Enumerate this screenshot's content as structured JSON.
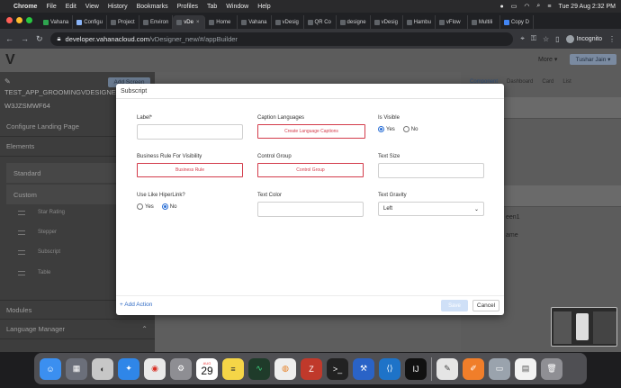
{
  "menubar": {
    "app": "Chrome",
    "items": [
      "File",
      "Edit",
      "View",
      "History",
      "Bookmarks",
      "Profiles",
      "Tab",
      "Window",
      "Help"
    ],
    "datetime": "Tue 29 Aug  2:32 PM"
  },
  "tabs": [
    "Vahana",
    "Configu",
    "Project",
    "Environ",
    "vDe",
    "Home",
    "Vahana",
    "vDesig",
    "QR Co",
    "designe",
    "vDesig",
    "Hambu",
    "vFlow",
    "Multili",
    "Copy D"
  ],
  "address": {
    "url_host": "developer.vahanacloud.com",
    "url_path": "/vDesigner_new/#/appBuilder",
    "incognito": "Incognito"
  },
  "app_header": {
    "more": "More",
    "user": "Tushar Jain"
  },
  "sidebar": {
    "add_screen": "Add Screen",
    "app_name": "TEST_APP_GROOMINGVDESIGNE...",
    "app_id": "W3JZSMWF64",
    "configure": "Configure Landing Page",
    "elements": "Elements",
    "standard": "Standard",
    "custom": "Custom",
    "items": [
      "Star Rating",
      "Stepper",
      "Subscript",
      "Table"
    ],
    "modules": "Modules",
    "language_manager": "Language Manager"
  },
  "right_panel": {
    "tabs": [
      "Component",
      "Dashboard",
      "Card",
      "List"
    ],
    "screen_text": "een1",
    "name_text": "ame"
  },
  "modal": {
    "title": "Subscript",
    "label": "Label*",
    "caption_languages": "Caption Languages",
    "create_language_captions": "Create Language Captions",
    "is_visible": "Is Visible",
    "yes": "Yes",
    "no": "No",
    "business_rule_label": "Business Rule For Visibility",
    "business_rule_btn": "Business Rule",
    "control_group_label": "Control Group",
    "control_group_btn": "Control Group",
    "text_size": "Text Size",
    "use_like_hyperlink": "Use Like HiperLink?",
    "text_color": "Text Color",
    "text_gravity": "Text Gravity",
    "text_gravity_value": "Left",
    "add_action": "+ Add Action",
    "save": "Save",
    "cancel": "Cancel"
  },
  "dock": {
    "calendar_month": "AUG",
    "calendar_day": "29"
  },
  "colors": {
    "accent_red": "#d33b4a",
    "accent_blue": "#2a6fd6",
    "link_blue": "#2f6ac4"
  }
}
